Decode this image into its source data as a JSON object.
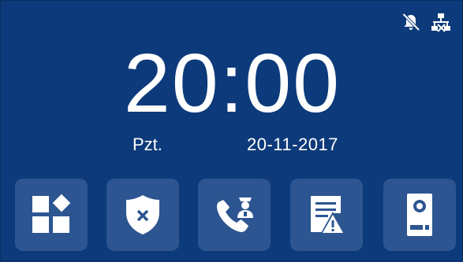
{
  "status": {
    "icons": [
      "bell-muted-icon",
      "network-icon"
    ]
  },
  "clock": {
    "time": "20:00",
    "day": "Pzt.",
    "date": "20-11-2017"
  },
  "dock": {
    "tiles": [
      {
        "name": "apps",
        "icon": "apps-grid-icon"
      },
      {
        "name": "security",
        "icon": "shield-x-icon"
      },
      {
        "name": "call-guard",
        "icon": "phone-guard-icon"
      },
      {
        "name": "alarm-log",
        "icon": "alert-document-icon"
      },
      {
        "name": "door-station",
        "icon": "door-station-icon"
      }
    ]
  },
  "colors": {
    "background": "#0d3a7a",
    "tile": "#2c5591",
    "foreground": "#ffffff"
  }
}
